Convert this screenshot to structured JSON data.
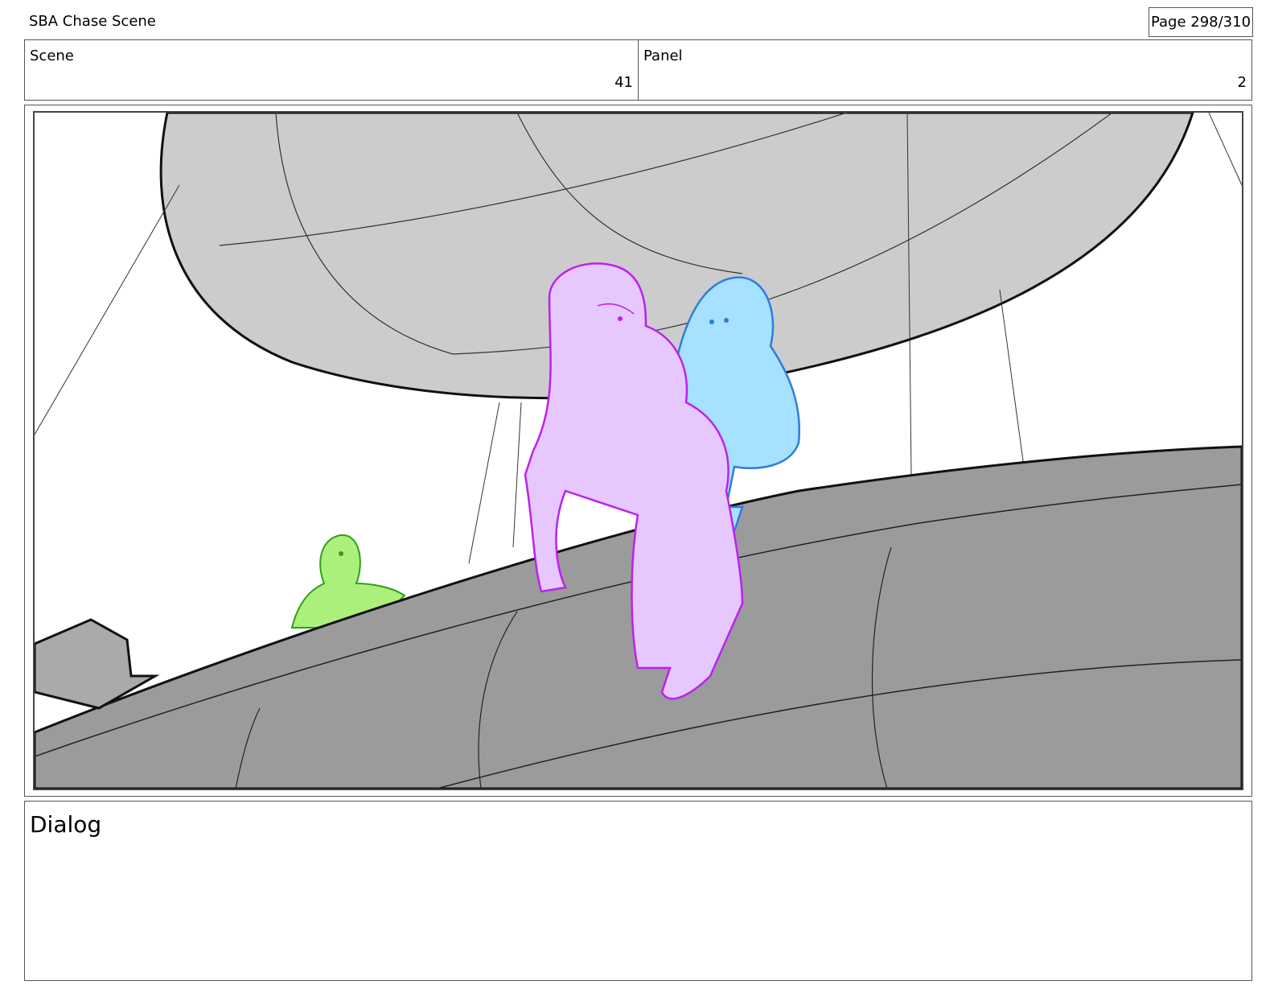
{
  "header": {
    "project_title": "SBA Chase Scene",
    "page_label": "Page 298/310"
  },
  "info": {
    "scene_label": "Scene",
    "scene_value": "41",
    "panel_label": "Panel",
    "panel_value": "2"
  },
  "panel_image": {
    "description_icon": "storyboard-sketch",
    "colors": {
      "balloon": "#cccccc",
      "hull": "#9b9b9b",
      "purple_character": "#e6c8ff",
      "purple_line": "#bb22ee",
      "blue_character": "#a6e1ff",
      "blue_line": "#2f7ddc",
      "green_character": "#aaf07a",
      "green_line": "#2f9f1a"
    }
  },
  "dialog": {
    "label": "Dialog",
    "text": ""
  }
}
